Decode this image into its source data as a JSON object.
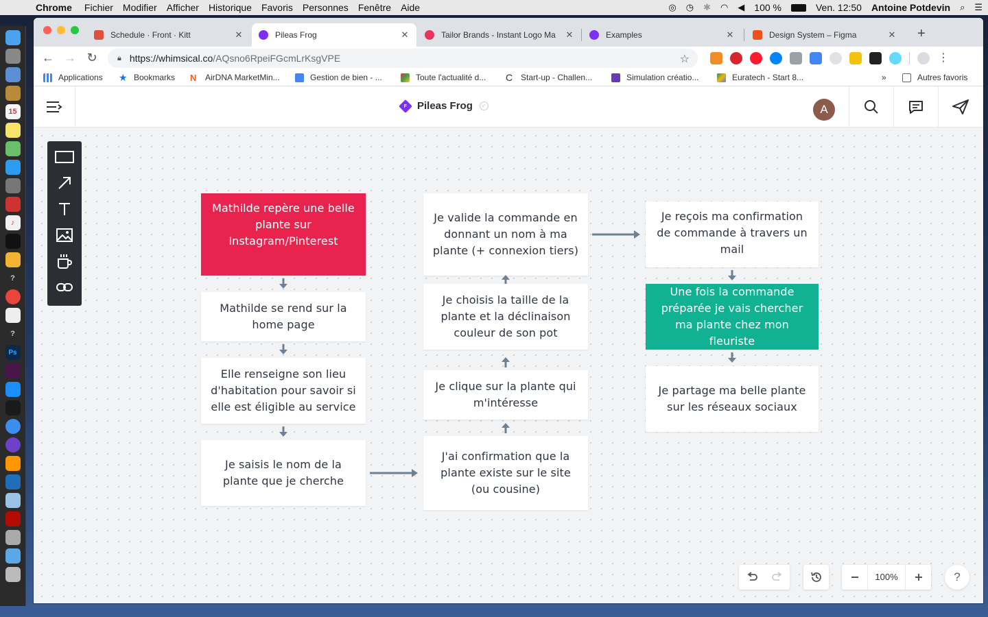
{
  "menubar": {
    "app": "Chrome",
    "items": [
      "Fichier",
      "Modifier",
      "Afficher",
      "Historique",
      "Favoris",
      "Personnes",
      "Fenêtre",
      "Aide"
    ],
    "battery": "100 %",
    "clock": "Ven. 12:50",
    "user": "Antoine Potdevin"
  },
  "tabs": [
    {
      "title": "Schedule · Front · Kitt",
      "color": "#e0513c"
    },
    {
      "title": "Pileas Frog",
      "color": "#7b2ff7"
    },
    {
      "title": "Tailor Brands - Instant Logo Ma",
      "color": "#e8345a"
    },
    {
      "title": "Examples",
      "color": "#7b2ff7"
    },
    {
      "title": "Design System – Figma",
      "color": "#f24e1e"
    }
  ],
  "address": {
    "host": "https://whimsical.co",
    "path": "/AQsno6RpeiFGcmLrKsgVPE"
  },
  "bookmarks": [
    {
      "label": "Applications",
      "color": "#4285f4"
    },
    {
      "label": "Bookmarks",
      "color": "#1a73e8"
    },
    {
      "label": "AirDNA MarketMin...",
      "color": "#ff5a1f"
    },
    {
      "label": "Gestion de bien - ...",
      "color": "#4285f4"
    },
    {
      "label": "Toute l'actualité d...",
      "color": "#e53935"
    },
    {
      "label": "Start-up - Challen...",
      "color": "#333333"
    },
    {
      "label": "Simulation créatio...",
      "color": "#673ab7"
    },
    {
      "label": "Euratech - Start 8...",
      "color": "#0f9d58"
    }
  ],
  "bookmarks_more": "»",
  "bookmarks_other": "Autres favoris",
  "doc": {
    "title": "Pileas Frog",
    "badge": "F",
    "avatar": "A"
  },
  "tools": [
    "rectangle-tool",
    "arrow-tool",
    "text-tool",
    "image-tool",
    "cup-tool",
    "link-tool"
  ],
  "flow": {
    "col1": [
      "Mathilde repère une belle plante sur Instagram/Pinterest",
      "Mathilde se rend sur la home page",
      "Elle renseigne son lieu d'habitation pour savoir si elle est éligible au service",
      "Je saisis le nom de la plante que je cherche"
    ],
    "col2": [
      "Je valide la commande en donnant un nom à ma plante (+ connexion tiers)",
      "Je choisis la taille de la plante et la déclinaison couleur de son pot",
      "Je clique sur la plante qui m'intéresse",
      "J'ai confirmation que la plante existe sur le site (ou cousine)"
    ],
    "col3": [
      "Je reçois ma confirmation de commande à travers un mail",
      "Une fois la commande préparée je vais chercher ma plante chez mon fleuriste",
      "Je partage ma belle plante sur les réseaux sociaux"
    ],
    "colors": {
      "highlight_red": "#e8234e",
      "highlight_teal": "#11b193",
      "connector": "#6f8090"
    }
  },
  "zoom": "100%",
  "help": "?"
}
